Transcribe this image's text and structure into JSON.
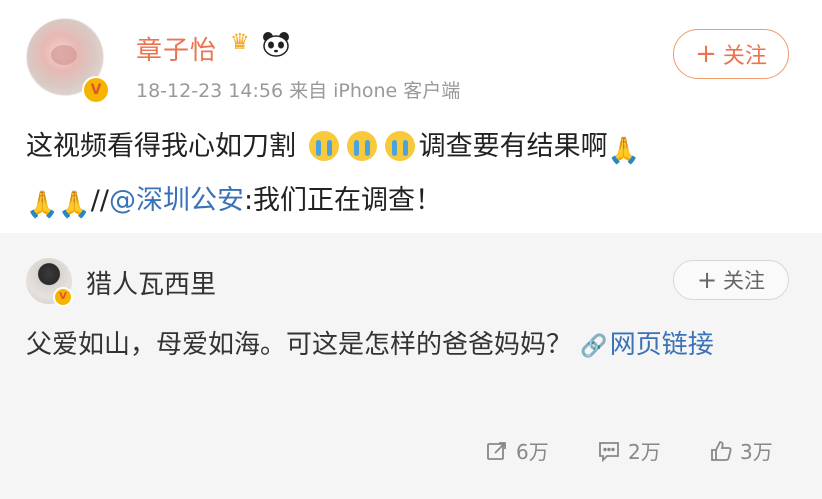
{
  "post": {
    "author": "章子怡",
    "badge_icons": [
      "crown-icon",
      "panda-icon"
    ],
    "meta": "18-12-23 14:56  来自 iPhone 客户端",
    "follow_label": "关注",
    "text_part1": "这视频看得我心如刀割",
    "text_part2": "调查要有结果啊",
    "text_part3": "//",
    "mention": "@深圳公安",
    "text_part4": ":我们正在调查！",
    "emojis": {
      "cry": "cry-emoji",
      "pray": "🙏"
    }
  },
  "comment": {
    "author": "猎人瓦西里",
    "follow_label": "关注",
    "text": "父爱如山，母爱如海。可这是怎样的爸爸妈妈？",
    "link_label": "网页链接"
  },
  "actions": {
    "share": "6万",
    "comments": "2万",
    "likes": "3万"
  },
  "colors": {
    "accent": "#eb7350",
    "link": "#3a72b8",
    "comment_bg": "#f5f5f5"
  }
}
